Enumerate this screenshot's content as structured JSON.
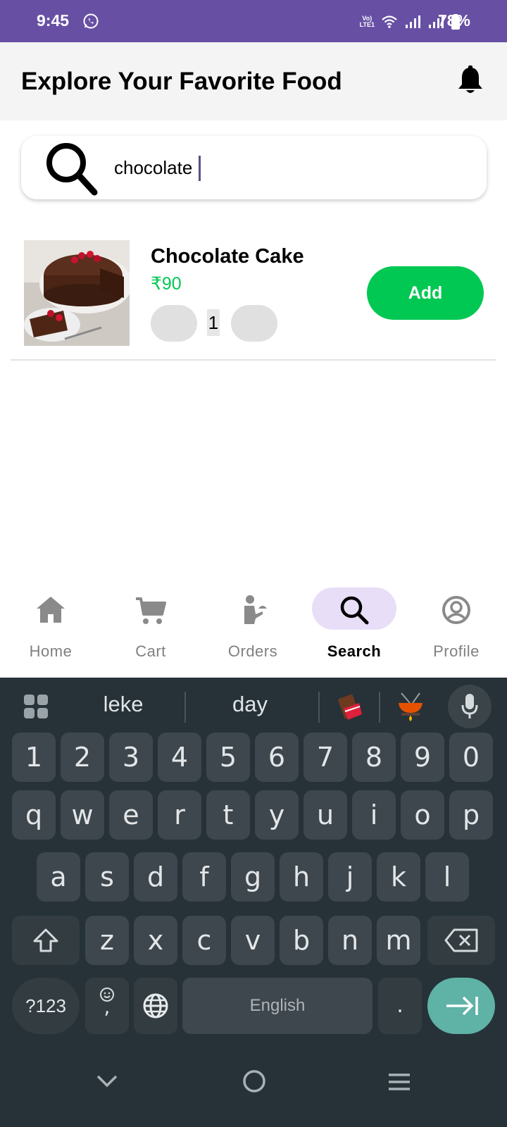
{
  "status_bar": {
    "time": "9:45",
    "volte_top": "Vo)",
    "volte_bottom": "LTE1",
    "battery": "78%",
    "bg_color": "#6750a4"
  },
  "header": {
    "title": "Explore Your Favorite Food",
    "bell_icon": "bell-icon"
  },
  "search": {
    "value": "chocolate",
    "placeholder": ""
  },
  "results": [
    {
      "name": "Chocolate Cake",
      "price": "₹90",
      "quantity": "1",
      "add_label": "Add"
    }
  ],
  "bottom_nav": [
    {
      "label": "Home",
      "icon": "home-icon",
      "active": false
    },
    {
      "label": "Cart",
      "icon": "cart-icon",
      "active": false
    },
    {
      "label": "Orders",
      "icon": "waiter-icon",
      "active": false
    },
    {
      "label": "Search",
      "icon": "search-icon",
      "active": true
    },
    {
      "label": "Profile",
      "icon": "profile-icon",
      "active": false
    }
  ],
  "keyboard": {
    "suggestions": [
      "leke",
      "day"
    ],
    "emoji_suggestions": [
      "chocolate-bar-emoji",
      "fondue-emoji"
    ],
    "row_numbers": [
      "1",
      "2",
      "3",
      "4",
      "5",
      "6",
      "7",
      "8",
      "9",
      "0"
    ],
    "row1": [
      "q",
      "w",
      "e",
      "r",
      "t",
      "y",
      "u",
      "i",
      "o",
      "p"
    ],
    "row2": [
      "a",
      "s",
      "d",
      "f",
      "g",
      "h",
      "j",
      "k",
      "l"
    ],
    "row3": [
      "z",
      "x",
      "c",
      "v",
      "b",
      "n",
      "m"
    ],
    "symbols_label": "?123",
    "comma_label": ",",
    "space_label": "English",
    "period_label": "."
  },
  "colors": {
    "accent_green": "#00c853",
    "nav_pill": "#e8def8",
    "keyboard_bg": "#263238",
    "enter_key": "#5fb2a6"
  }
}
